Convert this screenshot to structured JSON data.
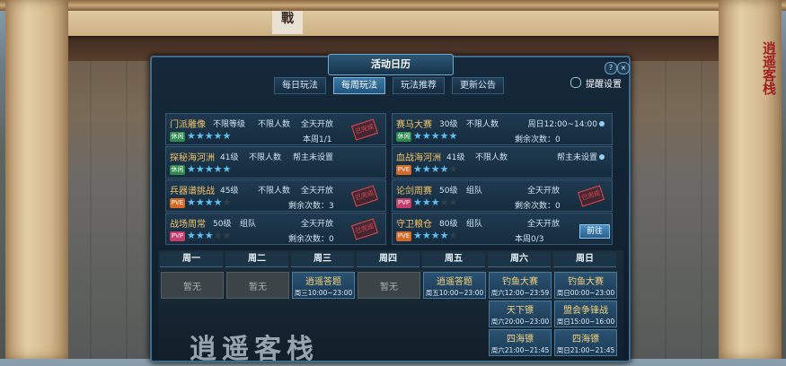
{
  "seal_text": "逍遥客栈",
  "banner_text": "戰",
  "window": {
    "title": "活动日历",
    "help": "?",
    "close": "×"
  },
  "tabs": [
    {
      "label": "每日玩法",
      "active": false
    },
    {
      "label": "每周玩法",
      "active": true
    },
    {
      "label": "玩法推荐",
      "active": false
    },
    {
      "label": "更新公告",
      "active": false
    }
  ],
  "remind_label": "提醒设置",
  "activities": [
    {
      "name": "门派雕像",
      "level": "不限等级",
      "limit": "不限人数",
      "time": "全天开放",
      "tag": "休闲",
      "stars": 5,
      "count": "本周1/1",
      "stamp": "已完成"
    },
    {
      "name": "赛马大赛",
      "level": "30级",
      "limit": "不限人数",
      "time": "周日12:00~14:00",
      "tag": "休闲",
      "stars": 5,
      "count": "剩余次数：0"
    },
    {
      "name": "探秘海河洲",
      "level": "41级",
      "limit": "不限人数",
      "time": "帮主未设置",
      "tag": "休闲",
      "stars": 5,
      "count": ""
    },
    {
      "name": "血战海河洲",
      "level": "41级",
      "limit": "不限人数",
      "time": "帮主未设置",
      "tag": "PVE",
      "stars": 4,
      "count": ""
    },
    {
      "name": "兵器谱挑战",
      "level": "45级",
      "limit": "不限人数",
      "time": "全天开放",
      "tag": "PVE",
      "stars": 4,
      "count": "剩余次数：3",
      "stamp": "已完成"
    },
    {
      "name": "论剑周赛",
      "level": "50级",
      "limit": "组队",
      "time": "全天开放",
      "tag": "PVP",
      "stars": 3,
      "count": "剩余次数：0",
      "stamp": "已完成"
    },
    {
      "name": "战场周常",
      "level": "50级",
      "limit": "组队",
      "time": "全天开放",
      "tag": "PVP",
      "stars": 3,
      "count": "剩余次数：0",
      "stamp": "已完成"
    },
    {
      "name": "守卫粮仓",
      "level": "80级",
      "limit": "组队",
      "time": "全天开放",
      "tag": "PVE",
      "stars": 4,
      "count": "本周0/3",
      "button": "前往"
    }
  ],
  "week": {
    "days": [
      "周一",
      "周二",
      "周三",
      "周四",
      "周五",
      "周六",
      "周日"
    ],
    "slots": [
      [
        {
          "name": "暂无",
          "time": "",
          "empty": true
        }
      ],
      [
        {
          "name": "暂无",
          "time": "",
          "empty": true
        }
      ],
      [
        {
          "name": "逍遥答题",
          "time": "周三10:00~23:00"
        }
      ],
      [
        {
          "name": "暂无",
          "time": "",
          "empty": true
        }
      ],
      [
        {
          "name": "逍遥答题",
          "time": "周五10:00~23:00"
        }
      ],
      [
        {
          "name": "钓鱼大赛",
          "time": "周六12:00~23:59"
        },
        {
          "name": "天下镖",
          "time": "周六20:00~23:00"
        },
        {
          "name": "四海镖",
          "time": "周六21:00~21:45"
        }
      ],
      [
        {
          "name": "钓鱼大赛",
          "time": "周日00:00~23:00"
        },
        {
          "name": "盟会争锋战",
          "time": "周日15:00~16:00"
        },
        {
          "name": "四海镖",
          "time": "周日21:00~21:45"
        }
      ]
    ]
  },
  "watermark": "逍遥客栈"
}
